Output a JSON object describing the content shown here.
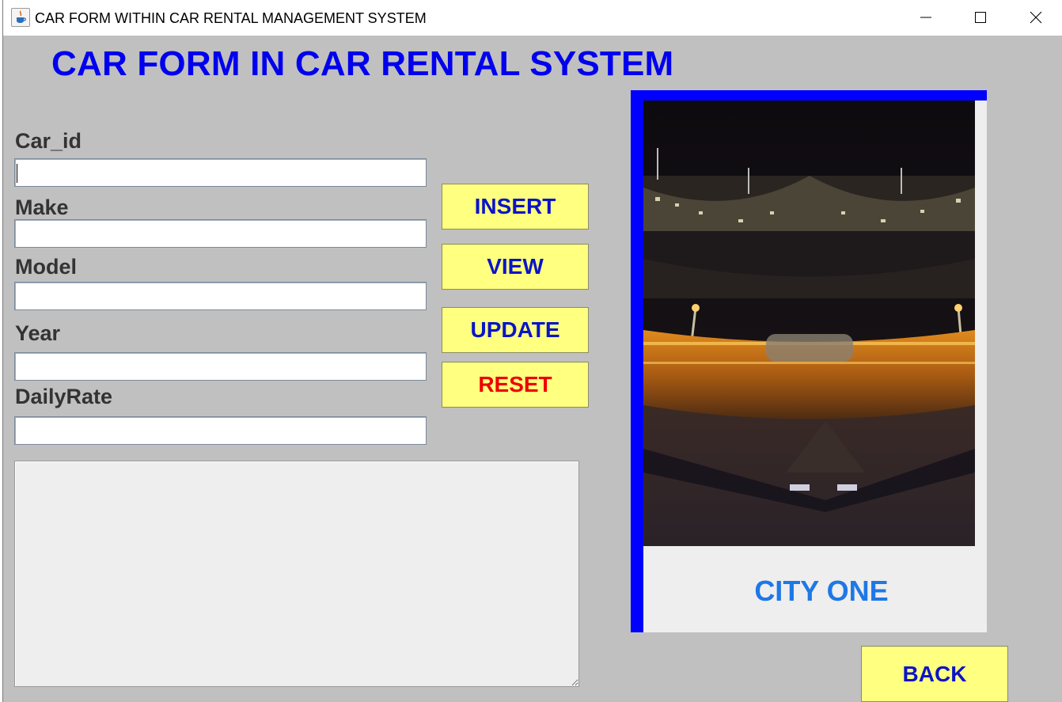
{
  "window": {
    "title": "CAR FORM WITHIN CAR RENTAL MANAGEMENT SYSTEM",
    "app_icon": "java-cup-icon"
  },
  "heading": "CAR FORM IN CAR RENTAL SYSTEM",
  "form": {
    "fields": [
      {
        "label": "Car_id",
        "value": "",
        "focused": true
      },
      {
        "label": "Make",
        "value": ""
      },
      {
        "label": "Model",
        "value": ""
      },
      {
        "label": "Year",
        "value": ""
      },
      {
        "label": "DailyRate",
        "value": ""
      }
    ]
  },
  "buttons": {
    "insert": "INSERT",
    "view": "VIEW",
    "update": "UPDATE",
    "reset": "RESET",
    "back": "BACK"
  },
  "output_area": {
    "value": ""
  },
  "image_panel": {
    "caption": "CITY ONE",
    "image_icon": "night-city-photo",
    "border_color": "#0000ff"
  },
  "colors": {
    "background": "#c0c0c0",
    "heading": "#0000ee",
    "button_fill": "#ffff80",
    "button_text": "#0a14c8",
    "reset_text": "#ee0000",
    "caption": "#1e78e6"
  }
}
